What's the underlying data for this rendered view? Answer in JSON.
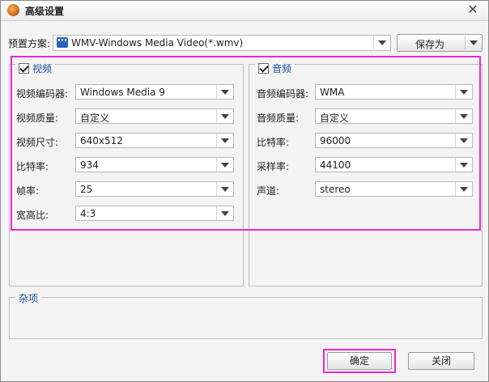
{
  "window": {
    "title": "高级设置",
    "close_symbol": "✕"
  },
  "preset": {
    "label": "预置方案:",
    "value": "WMV-Windows Media Video(*.wmv)",
    "save_as": "保存为"
  },
  "video": {
    "section_label": "视频",
    "rows": [
      {
        "label": "视频编码器:",
        "value": "Windows Media 9"
      },
      {
        "label": "视频质量:",
        "value": "自定义"
      },
      {
        "label": "视频尺寸:",
        "value": "640x512"
      },
      {
        "label": "比特率:",
        "value": "934"
      },
      {
        "label": "帧率:",
        "value": "25"
      },
      {
        "label": "宽高比:",
        "value": "4:3"
      }
    ]
  },
  "audio": {
    "section_label": "音频",
    "rows": [
      {
        "label": "音频编码器:",
        "value": "WMA"
      },
      {
        "label": "音频质量:",
        "value": "自定义"
      },
      {
        "label": "比特率:",
        "value": "96000"
      },
      {
        "label": "采样率:",
        "value": "44100"
      },
      {
        "label": "声道:",
        "value": "stereo"
      }
    ]
  },
  "misc": {
    "section_label": "杂项"
  },
  "footer": {
    "ok": "确定",
    "close": "关闭"
  },
  "colors": {
    "highlight": "#e52ad6",
    "legend_text": "#1a4fa0"
  }
}
